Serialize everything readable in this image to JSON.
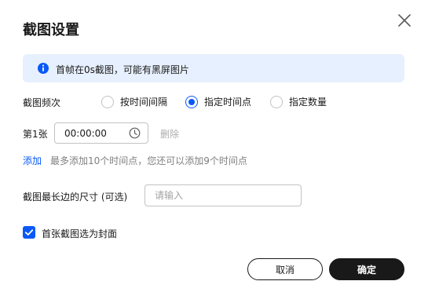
{
  "dialog": {
    "title": "截图设置",
    "close_icon": "close-icon"
  },
  "info": {
    "icon": "info-icon",
    "text": "首帧在0s截图，可能有黑屏图片"
  },
  "screenshot_frequency": {
    "label": "截图频次",
    "options": [
      {
        "label": "按时间间隔",
        "checked": false
      },
      {
        "label": "指定时间点",
        "checked": true
      },
      {
        "label": "指定数量",
        "checked": false
      }
    ]
  },
  "time_point": {
    "label": "第1张",
    "value": "00:00:00",
    "icon": "clock-icon",
    "delete_label": "删除"
  },
  "add": {
    "label": "添加",
    "hint": "最多添加10个时间点，您还可以添加9个时间点"
  },
  "max_edge": {
    "label": "截图最长边的尺寸 (可选)",
    "placeholder": "请输入",
    "value": ""
  },
  "cover": {
    "label": "首张截图选为封面",
    "checked": true
  },
  "footer": {
    "cancel_label": "取消",
    "ok_label": "确定"
  },
  "colors": {
    "accent": "#0a59f7",
    "info_bg": "#e7f0fe",
    "primary_button": "#191919",
    "disabled_text": "#adadad"
  }
}
